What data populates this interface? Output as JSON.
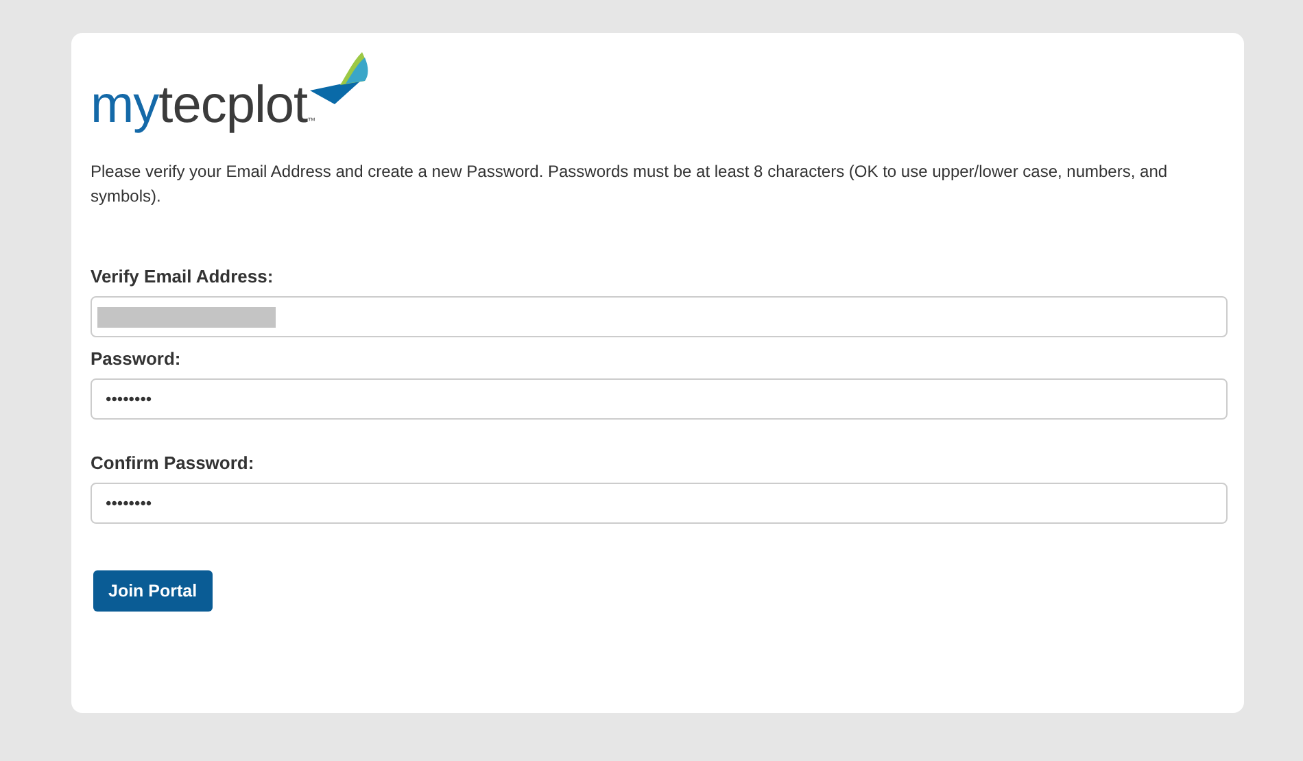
{
  "logo": {
    "prefix": "my",
    "name": "tecplot",
    "trademark": "™"
  },
  "intro": "Please verify your Email Address and create a new Password. Passwords must be at least 8 characters (OK to use upper/lower case, numbers, and symbols).",
  "fields": [
    {
      "label": "Verify Email Address:",
      "kind": "redacted"
    },
    {
      "label": "Password:",
      "kind": "password",
      "value": "••••••••"
    },
    {
      "label": "Confirm Password:",
      "kind": "password",
      "value": "••••••••"
    }
  ],
  "button": "Join Portal"
}
